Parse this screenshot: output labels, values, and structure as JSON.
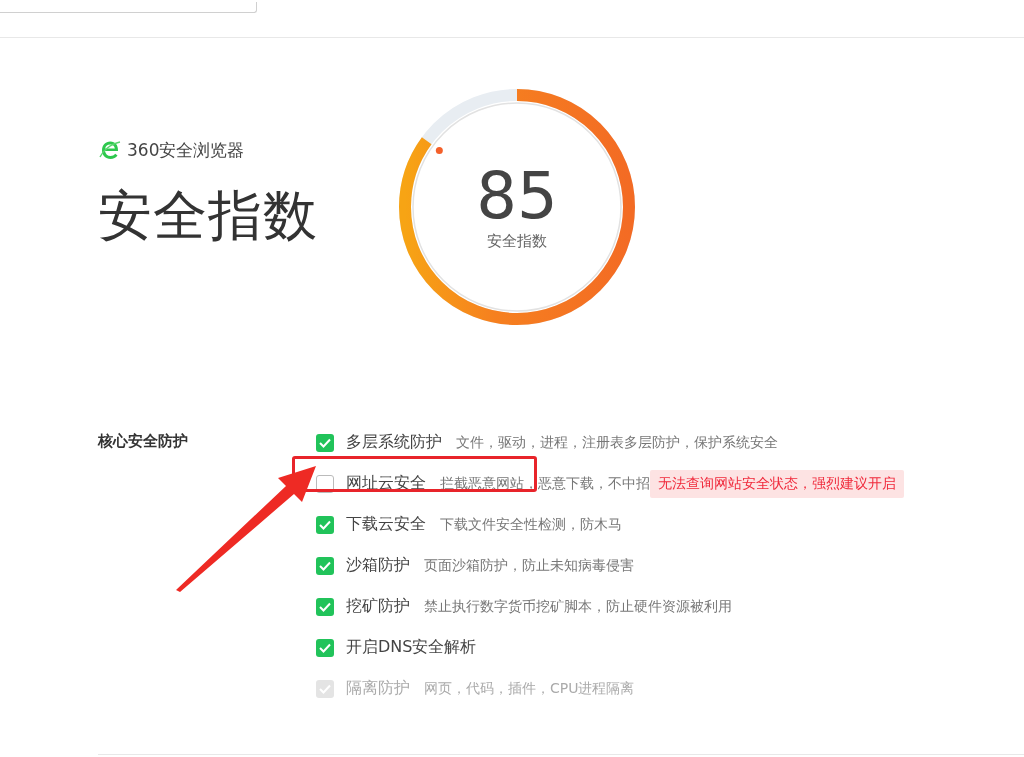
{
  "brand": {
    "name": "360安全浏览器"
  },
  "title": "安全指数",
  "gauge": {
    "score": "85",
    "label": "安全指数",
    "level": 0.85
  },
  "section": {
    "label": "核心安全防护",
    "options": [
      {
        "name": "多层系统防护",
        "description": "文件，驱动，进程，注册表多层防护，保护系统安全",
        "checked": true,
        "disabled": false
      },
      {
        "name": "网址云安全",
        "description": "拦截恶意网站，恶意下载，不中招",
        "checked": false,
        "disabled": false,
        "warning": "无法查询网站安全状态，强烈建议开启"
      },
      {
        "name": "下载云安全",
        "description": "下载文件安全性检测，防木马",
        "checked": true,
        "disabled": false
      },
      {
        "name": "沙箱防护",
        "description": "页面沙箱防护，防止未知病毒侵害",
        "checked": true,
        "disabled": false
      },
      {
        "name": "挖矿防护",
        "description": "禁止执行数字货币挖矿脚本，防止硬件资源被利用",
        "checked": true,
        "disabled": false
      },
      {
        "name": "开启DNS安全解析",
        "checked": true,
        "disabled": false
      },
      {
        "name": "隔离防护",
        "description": "网页，代码，插件，CPU进程隔离",
        "checked": true,
        "disabled": true
      }
    ]
  }
}
